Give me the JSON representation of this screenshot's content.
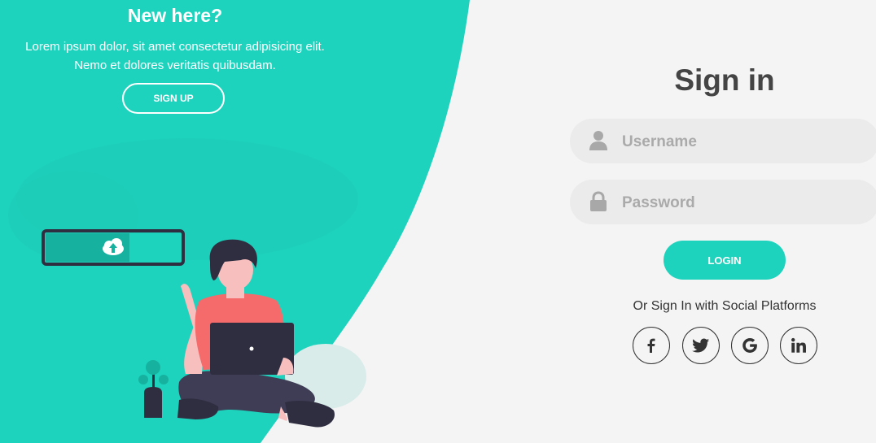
{
  "left_panel": {
    "heading": "New here?",
    "text_line1": "Lorem ipsum dolor, sit amet consectetur adipisicing elit.",
    "text_line2": "Nemo et dolores veritatis quibusdam.",
    "signup_label": "SIGN UP"
  },
  "form": {
    "title": "Sign in",
    "username_placeholder": "Username",
    "password_placeholder": "Password",
    "login_label": "LOGIN",
    "social_text": "Or Sign In with Social Platforms"
  },
  "social": [
    {
      "name": "facebook-icon",
      "glyph": "f"
    },
    {
      "name": "twitter-icon",
      "glyph": ""
    },
    {
      "name": "google-icon",
      "glyph": "G"
    },
    {
      "name": "linkedin-icon",
      "glyph": "in"
    }
  ],
  "colors": {
    "accent": "#1dd3bd",
    "background": "#f4f4f4",
    "field": "#ebebeb",
    "title": "#444444"
  }
}
